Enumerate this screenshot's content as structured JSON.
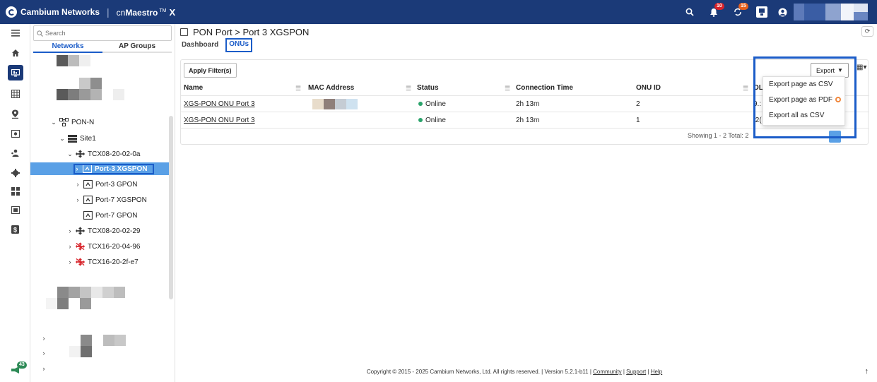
{
  "topbar": {
    "brand": "Cambium Networks",
    "product_prefix": "cn",
    "product_name": "Maestro",
    "product_tm": "TM",
    "product_x": "X",
    "alerts_count": "10",
    "sync_count": "15"
  },
  "rail": {
    "bottom_badge": "43"
  },
  "tree": {
    "search_placeholder": "Search",
    "tabs": [
      "Networks",
      "AP Groups"
    ],
    "nodes": {
      "pon_n": "PON-N",
      "site1": "Site1",
      "tcx_0a": "TCX08-20-02-0a",
      "port3_xgspon": "Port-3 XGSPON",
      "port3_gpon": "Port-3 GPON",
      "port7_xgspon": "Port-7 XGSPON",
      "port7_gpon": "Port-7 GPON",
      "tcx_29": "TCX08-20-02-29",
      "tcx16_96": "TCX16-20-04-96",
      "tcx16_e7": "TCX16-20-2f-e7"
    }
  },
  "main": {
    "breadcrumb": "PON Port > Port 3 XGSPON",
    "tabs": [
      "Dashboard",
      "ONUs"
    ],
    "apply_filter": "Apply Filter(s)",
    "export_label": "Export",
    "columns": [
      "Name",
      "MAC Address",
      "Status",
      "Connection Time",
      "ONU ID",
      "OL"
    ],
    "rows": [
      {
        "name": "XGS-PON ONU Port 3",
        "status": "Online",
        "connection_time": "2h 13m",
        "onu_id": "2",
        "ol": "9.:"
      },
      {
        "name": "XGS-PON ONU Port 3",
        "status": "Online",
        "connection_time": "2h 13m",
        "onu_id": "1",
        "ol": ":2("
      }
    ],
    "showing": "Showing 1 - 2 Total: 2",
    "export_menu": [
      "Export page as CSV",
      "Export page as PDF",
      "Export all as CSV"
    ]
  },
  "footer": {
    "copyright": "Copyright © 2015 - 2025 Cambium Networks, Ltd. All rights reserved.",
    "version": "Version 5.2.1-b11",
    "links": [
      "Community",
      "Support",
      "Help"
    ]
  },
  "colors": {
    "topbar": "#1b3a78",
    "accent": "#1b5cc8",
    "selected_row": "#5aa0e6",
    "online": "#2aa36b"
  }
}
